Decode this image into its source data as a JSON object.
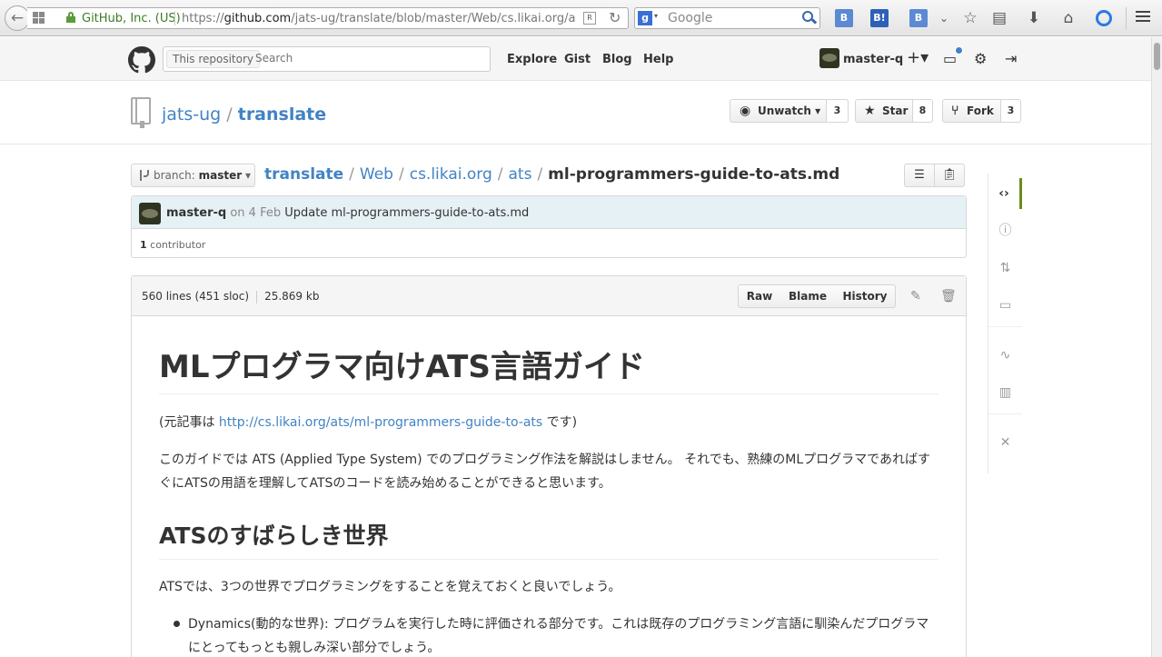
{
  "browser": {
    "site_identity": "GitHub, Inc. (US)",
    "url_prefix": "https://",
    "url_host": "github.com",
    "url_path": "/jats-ug/translate/blob/master/Web/cs.likai.org/a",
    "reader_label": "R",
    "reload_glyph": "C",
    "search_placeholder": "Google",
    "search_engine_letter": "g",
    "toolbar": {
      "addon1": "B",
      "addon2": "B!",
      "addon3": "B"
    }
  },
  "github": {
    "scope_label": "This repository",
    "search_placeholder": "Search",
    "nav": [
      "Explore",
      "Gist",
      "Blog",
      "Help"
    ],
    "username": "master-q",
    "plus_icon": "+▾"
  },
  "repo": {
    "owner": "jats-ug",
    "separator": "/",
    "name": "translate",
    "unwatch_label": "Unwatch",
    "unwatch_count": "3",
    "star_label": "Star",
    "star_count": "8",
    "fork_label": "Fork",
    "fork_count": "3"
  },
  "file_nav": {
    "branch_prefix": "branch:",
    "branch_name": "master",
    "crumbs": [
      "translate",
      "Web",
      "cs.likai.org",
      "ats"
    ],
    "filename": "ml-programmers-guide-to-ats.md"
  },
  "commit": {
    "author": "master-q",
    "date": "on 4 Feb",
    "message": "Update ml-programmers-guide-to-ats.md",
    "contributor_count": "1",
    "contributor_label": "contributor"
  },
  "file": {
    "lines": "560 lines (451 sloc)",
    "size": "25.869 kb",
    "raw_label": "Raw",
    "blame_label": "Blame",
    "history_label": "History"
  },
  "content": {
    "h1": "MLプログラマ向けATS言語ガイド",
    "source_prefix": "(元記事は ",
    "source_link": "http://cs.likai.org/ats/ml-programmers-guide-to-ats",
    "source_suffix": " です)",
    "intro": "このガイドでは ATS (Applied Type System) でのプログラミング作法を解説はしません。 それでも、熟練のMLプログラマであればすぐにATSの用語を理解してATSのコードを読み始めることができると思います。",
    "h2": "ATSのすばらしき世界",
    "p2": "ATSでは、3つの世界でプログラミングをすることを覚えておくと良いでしょう。",
    "li1": "Dynamics(動的な世界): プログラムを実行した時に評価される部分です。これは既存のプログラミング言語に馴染んだプログラマにとってもっとも親しみ深い部分でしょう。"
  }
}
